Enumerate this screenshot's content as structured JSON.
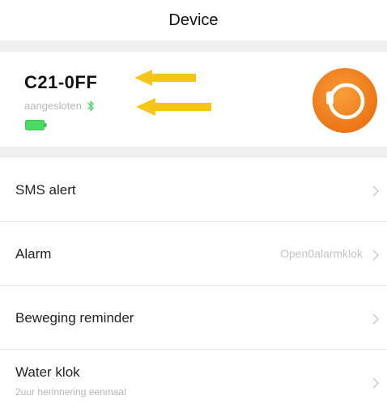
{
  "header": {
    "title": "Device"
  },
  "device": {
    "name": "C21-0FF",
    "status": "aangesloten",
    "bluetooth_icon": "bluetooth-icon",
    "battery_icon": "battery-icon",
    "battery_color": "#4cd964",
    "watch_icon": "smartwatch-icon",
    "accent_color": "#f2821a",
    "annotation_color": "#f5c518"
  },
  "settings": {
    "items": [
      {
        "label": "SMS alert",
        "value": "",
        "sub": ""
      },
      {
        "label": "Alarm",
        "value": "Open0alarmklok",
        "sub": ""
      },
      {
        "label": "Beweging reminder",
        "value": "",
        "sub": ""
      },
      {
        "label": "Water klok",
        "value": "",
        "sub": "2uur herinnering eenmaal"
      }
    ]
  }
}
